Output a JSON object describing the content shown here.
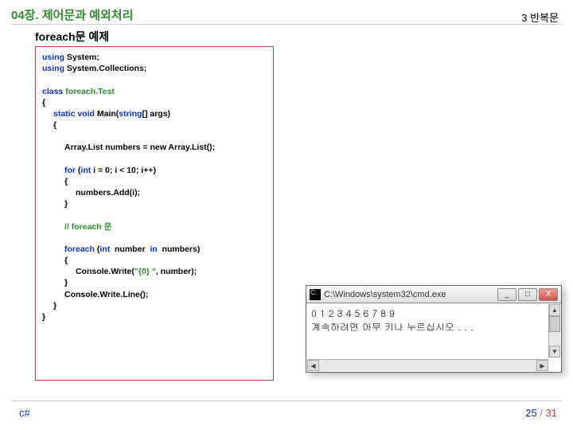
{
  "header": {
    "chapter": "04장. 제어문과 예외처리",
    "section": "3 반복문"
  },
  "subheader": "foreach문 예제",
  "code": {
    "l1a": "using",
    "l1b": " System;",
    "l2a": "using",
    "l2b": " System.Collections;",
    "l4a": "class ",
    "l4b": "foreach.Test",
    "l5": "{",
    "l6a": "static void",
    "l6b": " Main(",
    "l6c": "string",
    "l6d": "[] args)",
    "l7": "{",
    "l9": "Array.List numbers = new Array.List();",
    "l11a": "for",
    "l11b": " (",
    "l11c": "int",
    "l11d": " i = 0; i < 10; i++)",
    "l12": "{",
    "l13": "numbers.Add(i);",
    "l14": "}",
    "l16": "// foreach 문",
    "l18a": "foreach",
    "l18b": " (",
    "l18c": "int",
    "l18d": "  number  ",
    "l18e": "in",
    "l18f": "  numbers",
    "l18g": ")",
    "l19": "{",
    "l20a": "Console.Write(",
    "l20b": "\"{0} \"",
    "l20c": ", number);",
    "l21": "}",
    "l22": "Console.Write.Line();",
    "l23": "}",
    "l24": "}"
  },
  "console": {
    "title": "C:\\Windows\\system32\\cmd.exe",
    "line1": "0 1 2 3 4 5 6 7 8 9",
    "line2": "계속하려면 아무 키나 누르십시오 . . .",
    "min": "_",
    "max": "□",
    "close": "X",
    "up": "▲",
    "down": "▼",
    "left": "◀",
    "right": "▶"
  },
  "footer": {
    "lang": "c#",
    "pageCur": "25",
    "pageSep": " / ",
    "pageTot": "31"
  }
}
